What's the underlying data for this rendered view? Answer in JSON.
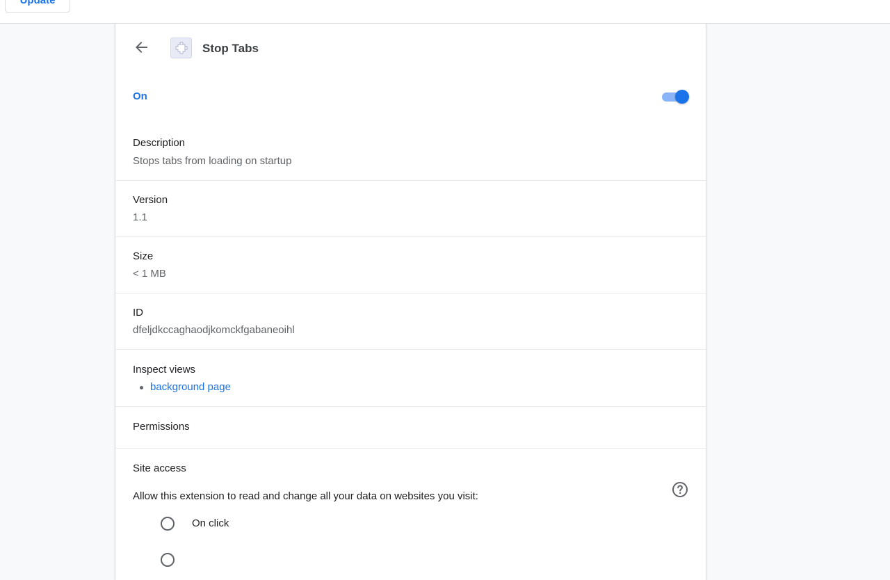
{
  "toolbar": {
    "update_label": "Update"
  },
  "extension": {
    "name": "Stop Tabs",
    "icon": "puzzle-piece-icon",
    "enabled_label": "On",
    "enabled": true
  },
  "details": {
    "description_label": "Description",
    "description_value": "Stops tabs from loading on startup",
    "version_label": "Version",
    "version_value": "1.1",
    "size_label": "Size",
    "size_value": "< 1 MB",
    "id_label": "ID",
    "id_value": "dfeljdkccaghaodjkomckfgabaneoihl",
    "inspect_label": "Inspect views",
    "inspect_links": [
      "background page"
    ],
    "permissions_label": "Permissions",
    "site_access_label": "Site access",
    "site_access_prompt": "Allow this extension to read and change all your data on websites you visit:",
    "site_access_options": [
      "On click"
    ]
  },
  "colors": {
    "accent": "#1a73e8",
    "toggle_track": "#8ab4f8",
    "background": "#f8f9fa",
    "card": "#ffffff",
    "divider": "#e8eaed"
  }
}
